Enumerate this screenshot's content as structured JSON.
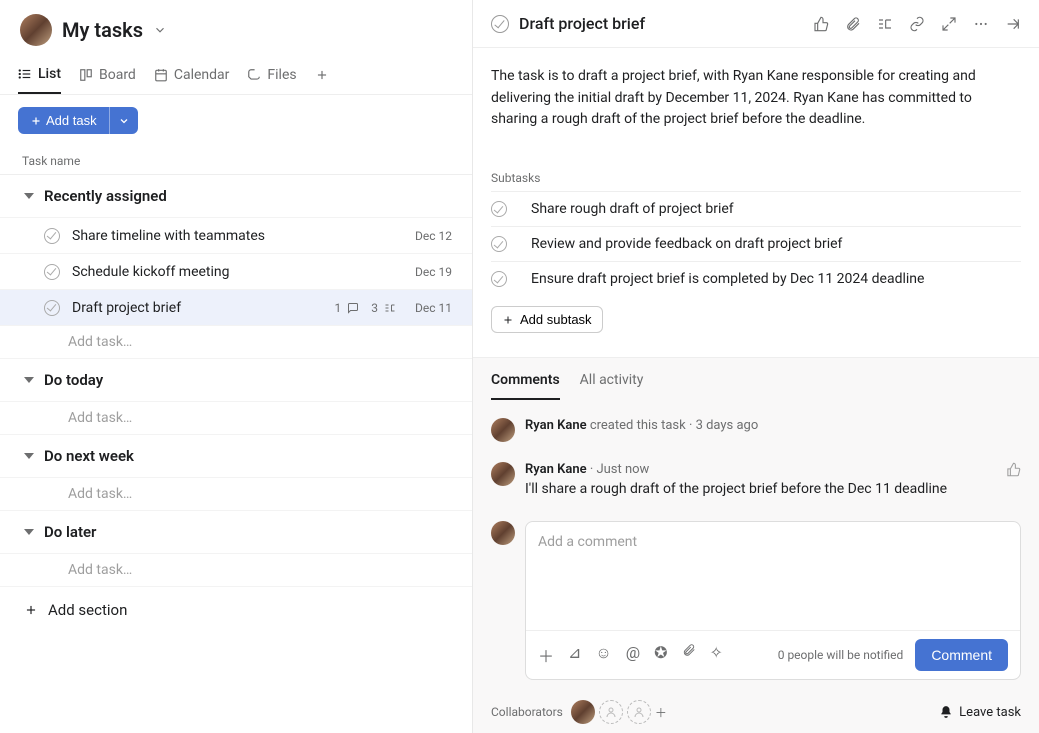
{
  "header": {
    "title": "My tasks"
  },
  "tabs": {
    "list": "List",
    "board": "Board",
    "calendar": "Calendar",
    "files": "Files"
  },
  "buttons": {
    "add_task": "Add task",
    "add_task_row": "Add task…",
    "add_section": "Add section",
    "add_subtask": "Add subtask",
    "comment": "Comment",
    "leave_task": "Leave task"
  },
  "columns": {
    "task_name": "Task name"
  },
  "sections": {
    "recently": {
      "title": "Recently assigned",
      "tasks": [
        {
          "name": "Share timeline with teammates",
          "date": "Dec 12"
        },
        {
          "name": "Schedule kickoff meeting",
          "date": "Dec 19"
        },
        {
          "name": "Draft project brief",
          "date": "Dec 11",
          "comments": "1",
          "subs": "3"
        }
      ]
    },
    "today": {
      "title": "Do today"
    },
    "next": {
      "title": "Do next week"
    },
    "later": {
      "title": "Do later"
    }
  },
  "detail": {
    "title": "Draft project brief",
    "description": "The task is to draft a project brief, with Ryan Kane responsible for creating and delivering the initial draft by December 11, 2024. Ryan Kane has committed to sharing a rough draft of the project brief before the deadline.",
    "subtasks_label": "Subtasks",
    "subtasks": [
      "Share rough draft of project brief",
      "Review and provide feedback on draft project brief",
      "Ensure draft project brief is completed by Dec 11 2024 deadline"
    ]
  },
  "activity": {
    "tabs": {
      "comments": "Comments",
      "all": "All activity"
    },
    "items": [
      {
        "author": "Ryan Kane",
        "action": "created this task",
        "time": "3 days ago"
      },
      {
        "author": "Ryan Kane",
        "time": "Just now",
        "body": "I'll share a rough draft of the project brief before the Dec 11 deadline"
      }
    ],
    "comment_placeholder": "Add a comment",
    "notify": "0 people will be notified",
    "collaborators_label": "Collaborators"
  }
}
